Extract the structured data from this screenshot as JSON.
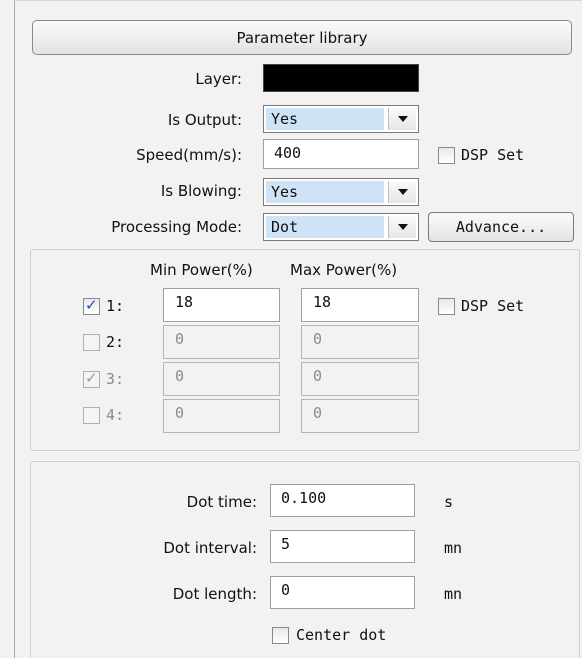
{
  "header": {
    "parameter_library_label": "Parameter library"
  },
  "layer": {
    "label": "Layer:",
    "color": "#000000"
  },
  "is_output": {
    "label": "Is Output:",
    "value": "Yes"
  },
  "speed": {
    "label": "Speed(mm/s):",
    "value": "400",
    "dsp_label": "DSP Set",
    "dsp_checked": false
  },
  "is_blowing": {
    "label": "Is Blowing:",
    "value": "Yes"
  },
  "processing_mode": {
    "label": "Processing Mode:",
    "value": "Dot",
    "advance_label": "Advance..."
  },
  "power": {
    "min_header": "Min Power(%)",
    "max_header": "Max Power(%)",
    "dsp_label": "DSP Set",
    "dsp_checked": false,
    "rows": [
      {
        "label": "1:",
        "min": "18",
        "max": "18",
        "checked": true,
        "enabled": true
      },
      {
        "label": "2:",
        "min": "0",
        "max": "0",
        "checked": false,
        "enabled": false
      },
      {
        "label": "3:",
        "min": "0",
        "max": "0",
        "checked": true,
        "enabled": false
      },
      {
        "label": "4:",
        "min": "0",
        "max": "0",
        "checked": false,
        "enabled": false
      }
    ]
  },
  "dot": {
    "time_label": "Dot time:",
    "time_value": "0.100",
    "time_unit": "s",
    "interval_label": "Dot interval:",
    "interval_value": "5",
    "interval_unit": "mn",
    "length_label": "Dot length:",
    "length_value": "0",
    "length_unit": "mn",
    "center_label": "Center dot",
    "center_checked": false
  }
}
